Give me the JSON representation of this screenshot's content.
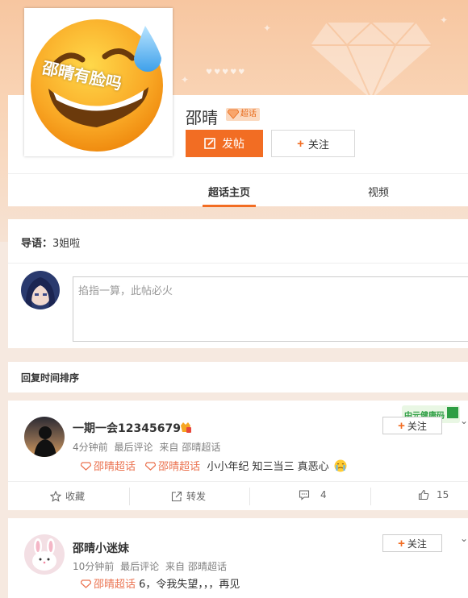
{
  "topic": {
    "name": "邵晴",
    "badge": "超话",
    "avatar_caption": "邵晴有脸吗",
    "post_button": "发帖",
    "follow_button": "关注"
  },
  "tabs": [
    {
      "label": "超话主页",
      "active": true
    },
    {
      "label": "视频",
      "active": false
    }
  ],
  "guide": {
    "label": "导语：",
    "text": "3姐啦"
  },
  "composer": {
    "placeholder": "掐指一算，此帖必火"
  },
  "sort": {
    "label": "回复时间排序"
  },
  "posts": [
    {
      "username": "一期一会12345679",
      "time": "4分钟前",
      "meta_mid": "最后评论",
      "source_prefix": "来自",
      "source": "邵晴超话",
      "topic_tags": [
        "邵晴超话",
        "邵晴超话"
      ],
      "text": "小小年纪 知三当三 真恶心",
      "follow_label": "关注",
      "sticker_text": "中元健康码",
      "actions": {
        "favorite": "收藏",
        "forward": "转发",
        "comment_count": "4",
        "like_count": "15"
      }
    },
    {
      "username": "邵晴小迷妹",
      "time": "10分钟前",
      "meta_mid": "最后评论",
      "source_prefix": "来自",
      "source": "邵晴超话",
      "topic_tags": [
        "邵晴超话"
      ],
      "text": "6，令我失望，，，再见",
      "follow_label": "关注"
    }
  ],
  "colors": {
    "accent": "#f26d23",
    "topic_link": "#eb7350",
    "banner": "#f7c6a0"
  }
}
